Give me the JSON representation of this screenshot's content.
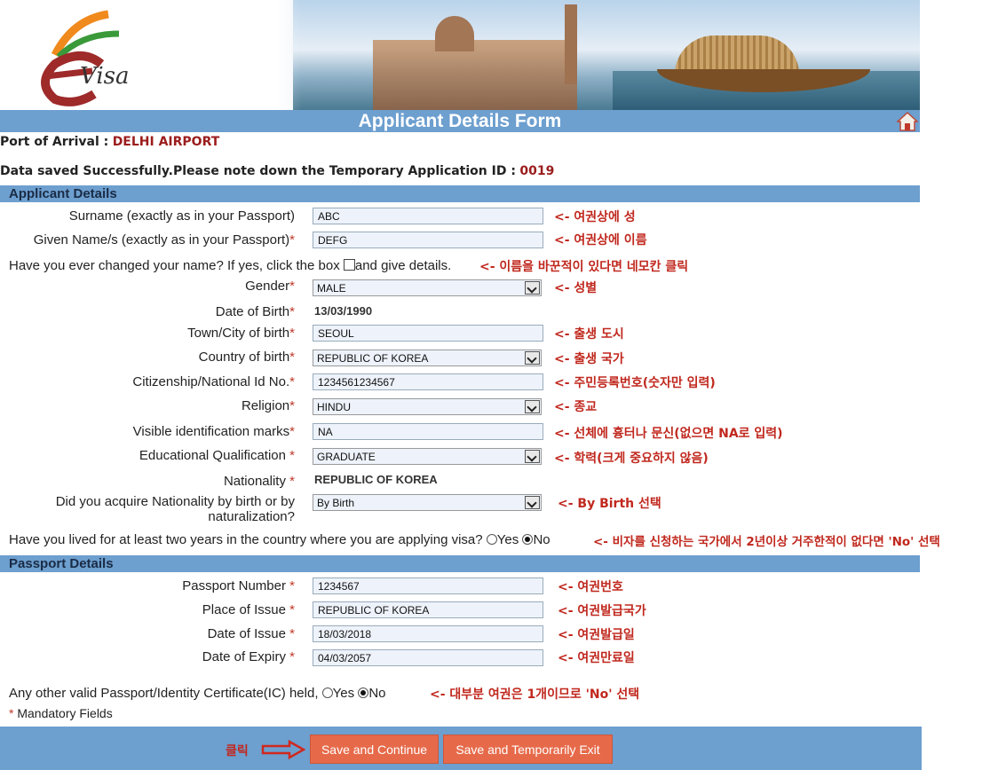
{
  "header": {
    "logo_text": "Visa",
    "title": "Applicant Details Form"
  },
  "port": {
    "label": "Port of Arrival :",
    "value": "DELHI AIRPORT"
  },
  "saved_message": {
    "text": "Data saved Successfully.Please note down the Temporary Application ID :",
    "id": "0019"
  },
  "applicant": {
    "section_title": "Applicant Details",
    "surname": {
      "label": "Surname (exactly as in your Passport)",
      "value": "ABC",
      "note": "<- 여권상에 성"
    },
    "given_name": {
      "label": "Given Name/s (exactly as in your Passport)",
      "value": "DEFG",
      "note": "<- 여권상에 이름"
    },
    "name_change": {
      "label": "Have you ever changed your name? If yes, click the box",
      "after": "and give details.",
      "note": "<- 이름을 바꾼적이 있다면 네모칸 클릭"
    },
    "gender": {
      "label": "Gender",
      "value": "MALE",
      "note": "<- 성별"
    },
    "dob": {
      "label": "Date of Birth",
      "value": "13/03/1990"
    },
    "town": {
      "label": "Town/City of birth",
      "value": "SEOUL",
      "note": "<- 출생 도시"
    },
    "country_birth": {
      "label": "Country of birth",
      "value": "REPUBLIC OF KOREA",
      "note": "<- 출생 국가"
    },
    "national_id": {
      "label": "Citizenship/National Id No.",
      "value": "1234561234567",
      "note": "<- 주민등록번호(숫자만 입력)"
    },
    "religion": {
      "label": "Religion",
      "value": "HINDU",
      "note": "<- 종교"
    },
    "marks": {
      "label": "Visible identification marks",
      "value": "NA",
      "note": "<- 선체에 흉터나 문신(없으면 NA로 입력)"
    },
    "education": {
      "label": "Educational Qualification",
      "value": "GRADUATE",
      "note": "<- 학력(크게 중요하지 않음)"
    },
    "nationality": {
      "label": "Nationality",
      "value": "REPUBLIC OF KOREA"
    },
    "acquire": {
      "label_line1": "Did you acquire Nationality by birth or by",
      "label_line2": "naturalization?",
      "value": "By Birth",
      "note": "<- By Birth 선택"
    },
    "lived": {
      "label": "Have you lived for at least two years in the country where you are applying visa?",
      "yes": "Yes",
      "no": "No",
      "selected": "No",
      "note": "<- 비자를 신청하는 국가에서 2년이상 거주한적이 없다면 'No' 선택"
    }
  },
  "passport": {
    "section_title": "Passport Details",
    "number": {
      "label": "Passport Number",
      "value": "1234567",
      "note": "<- 여권번호"
    },
    "place": {
      "label": "Place of Issue",
      "value": "REPUBLIC OF KOREA",
      "note": "<- 여권발급국가"
    },
    "issue_date": {
      "label": "Date of Issue",
      "value": "18/03/2018",
      "note": "<- 여권발급일"
    },
    "expiry": {
      "label": "Date of Expiry",
      "value": "04/03/2057",
      "note": "<- 여권만료일"
    },
    "other": {
      "label": "Any other valid Passport/Identity Certificate(IC) held,",
      "yes": "Yes",
      "no": "No",
      "selected": "No",
      "note": "<- 대부분 여권은 1개이므로 'No' 선택"
    }
  },
  "mandatory": "Mandatory Fields",
  "footer": {
    "click_note": "클릭",
    "save_continue": "Save and Continue",
    "save_exit": "Save and Temporarily Exit"
  },
  "colors": {
    "bar": "#6d9fcf",
    "note": "#c0281e",
    "button": "#e66a4a",
    "accent": "#9b1c1c"
  }
}
